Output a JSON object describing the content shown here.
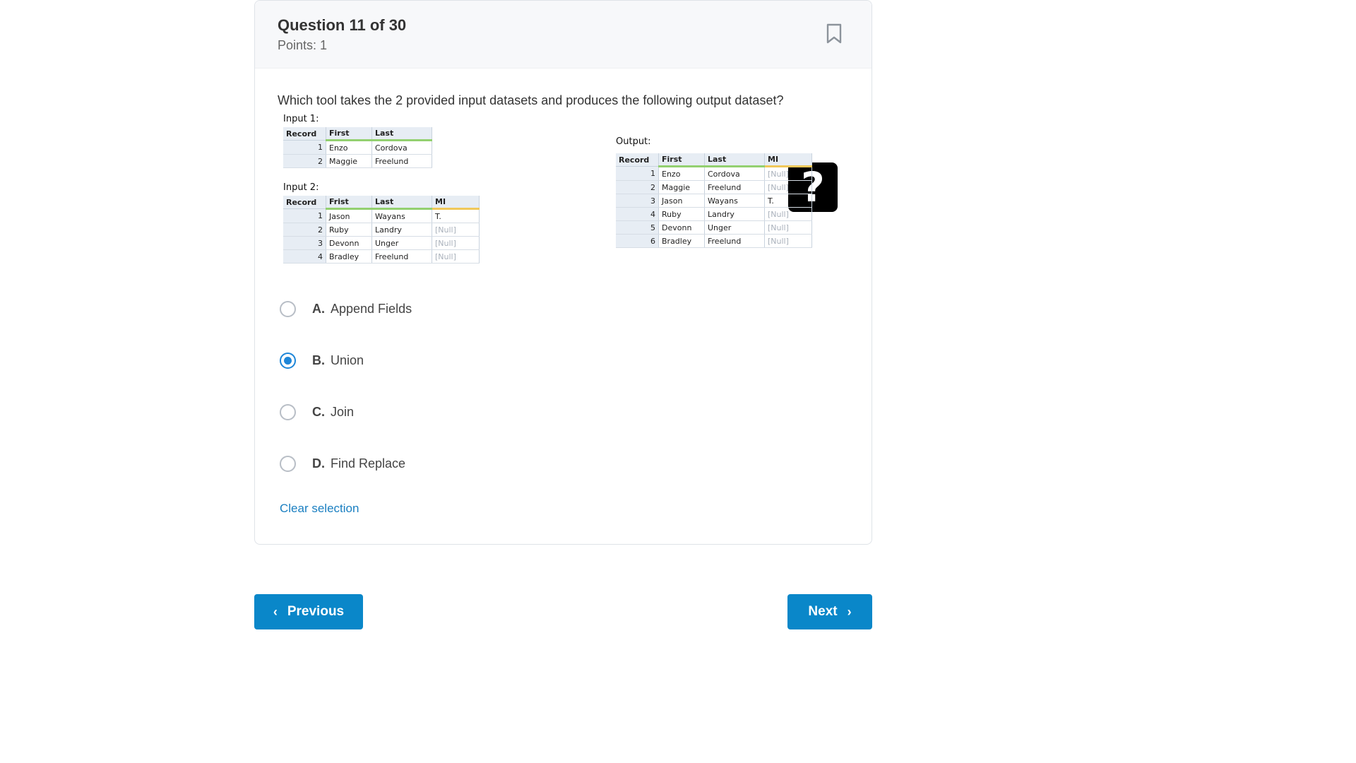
{
  "header": {
    "title": "Question 11 of 30",
    "points": "Points: 1",
    "bookmark_icon": "bookmark-icon"
  },
  "question": {
    "text": "Which tool takes the 2 provided input datasets and produces the following output dataset?"
  },
  "figure": {
    "input1": {
      "caption": "Input 1:",
      "headers": [
        "Record",
        "First",
        "Last"
      ],
      "rows": [
        [
          "1",
          "Enzo",
          "Cordova"
        ],
        [
          "2",
          "Maggie",
          "Freelund"
        ]
      ]
    },
    "input2": {
      "caption": "Input 2:",
      "headers": [
        "Record",
        "Frist",
        "Last",
        "MI"
      ],
      "rows": [
        [
          "1",
          "Jason",
          "Wayans",
          "T."
        ],
        [
          "2",
          "Ruby",
          "Landry",
          "[Null]"
        ],
        [
          "3",
          "Devonn",
          "Unger",
          "[Null]"
        ],
        [
          "4",
          "Bradley",
          "Freelund",
          "[Null]"
        ]
      ]
    },
    "question_mark": "?",
    "output": {
      "caption": "Output:",
      "headers": [
        "Record",
        "First",
        "Last",
        "MI"
      ],
      "rows": [
        [
          "1",
          "Enzo",
          "Cordova",
          "[Null]"
        ],
        [
          "2",
          "Maggie",
          "Freelund",
          "[Null]"
        ],
        [
          "3",
          "Jason",
          "Wayans",
          "T."
        ],
        [
          "4",
          "Ruby",
          "Landry",
          "[Null]"
        ],
        [
          "5",
          "Devonn",
          "Unger",
          "[Null]"
        ],
        [
          "6",
          "Bradley",
          "Freelund",
          "[Null]"
        ]
      ]
    }
  },
  "options": [
    {
      "letter": "A.",
      "text": "Append Fields",
      "selected": false
    },
    {
      "letter": "B.",
      "text": "Union",
      "selected": true
    },
    {
      "letter": "C.",
      "text": "Join",
      "selected": false
    },
    {
      "letter": "D.",
      "text": "Find Replace",
      "selected": false
    }
  ],
  "clear_selection": "Clear selection",
  "nav": {
    "previous": "Previous",
    "next": "Next"
  },
  "colors": {
    "accent": "#0a87c9",
    "radio_selected": "#1e86d8",
    "link": "#1a7fc1"
  }
}
